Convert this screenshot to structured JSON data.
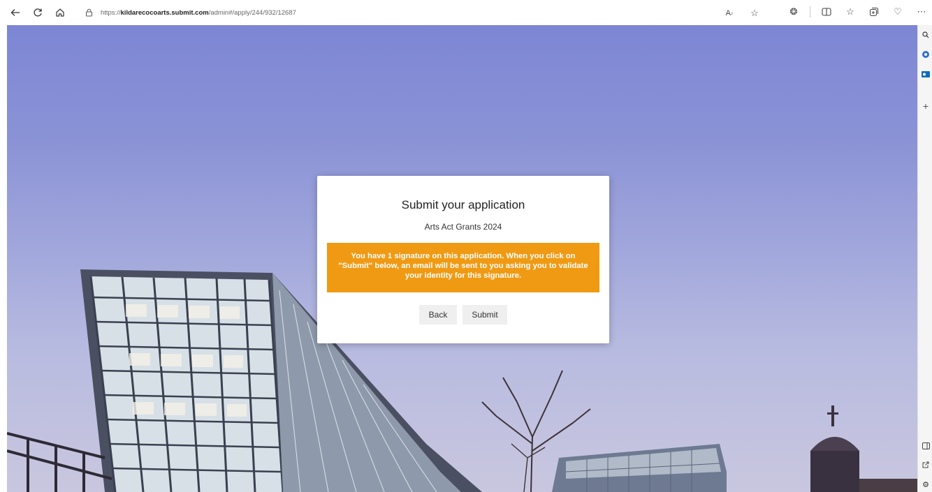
{
  "browser": {
    "url_prefix": "https://",
    "url_host": "kildarecocoarts.submit.com",
    "url_path": "/admin#/apply/244/932/12687",
    "icons": [
      "back-icon",
      "refresh-icon",
      "home-icon",
      "lock-icon",
      "read-aloud-icon",
      "favorite-star-icon",
      "extensions-icon",
      "split-screen-icon",
      "favorites-icon",
      "collections-icon",
      "performance-icon",
      "more-icon",
      "copilot-icon"
    ]
  },
  "sidebar": {
    "icons": [
      "search-icon",
      "shopping-icon",
      "outlook-icon",
      "add-icon",
      "sidebar-toggle-icon",
      "external-icon",
      "settings-icon"
    ]
  },
  "modal": {
    "title": "Submit your application",
    "subtitle": "Arts Act Grants 2024",
    "alert_text": "You have 1 signature on this application. When you click on \"Submit\" below, an email will be sent to you asking you to validate your identity for this signature.",
    "alert_color": "#f09a14",
    "back_label": "Back",
    "submit_label": "Submit"
  }
}
